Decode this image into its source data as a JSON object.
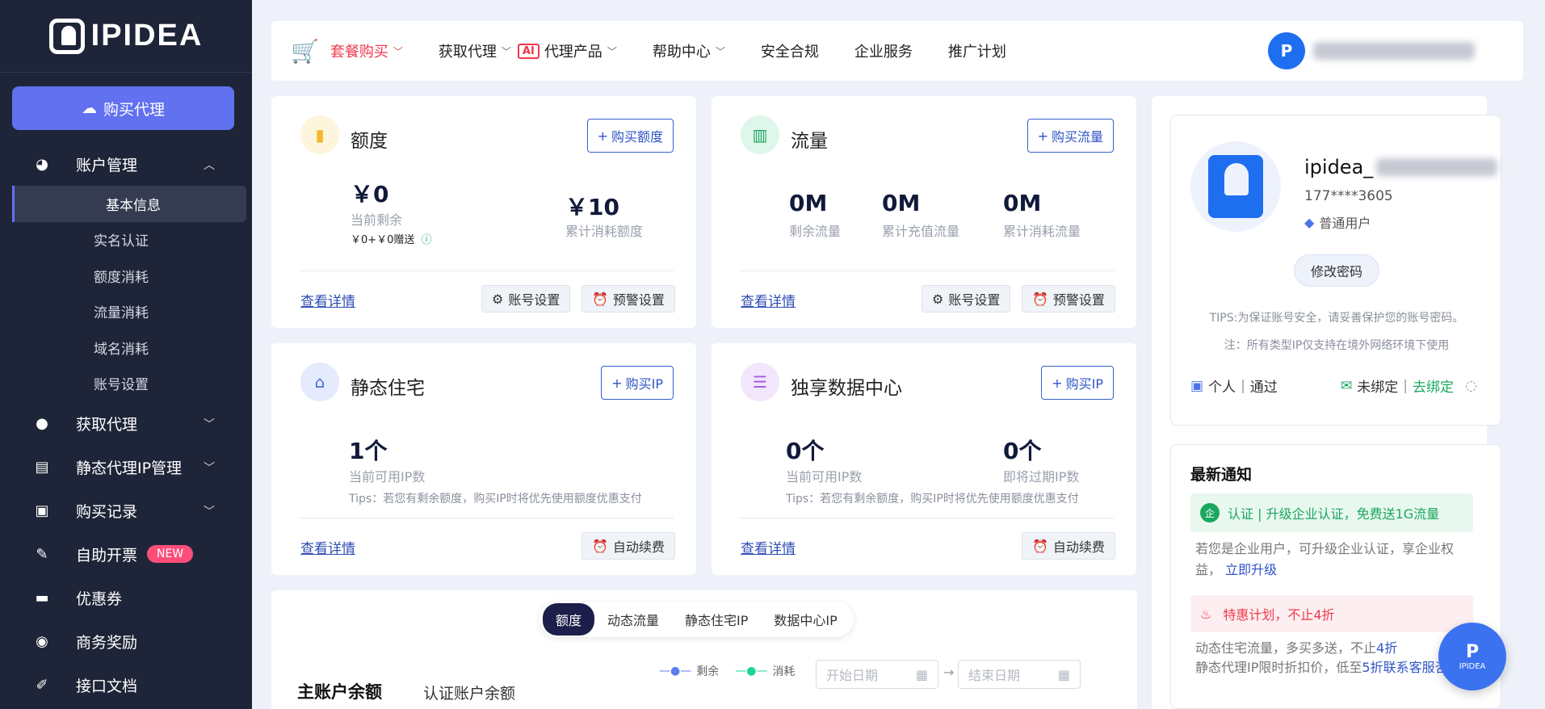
{
  "sidebar": {
    "logo_text": "IPIDEA",
    "buy_button": "购买代理",
    "menu": [
      {
        "label": "账户管理",
        "icon": "pie-chart-icon"
      },
      {
        "label": "获取代理",
        "icon": "user-pin-icon"
      },
      {
        "label": "静态代理IP管理",
        "icon": "static-ip-icon"
      },
      {
        "label": "购买记录",
        "icon": "basket-icon"
      },
      {
        "label": "自助开票",
        "icon": "invoice-icon",
        "badge": "NEW"
      },
      {
        "label": "优惠券",
        "icon": "coupon-icon"
      },
      {
        "label": "商务奖励",
        "icon": "reward-icon"
      },
      {
        "label": "接口文档",
        "icon": "doc-edit-icon"
      }
    ],
    "submenu": [
      "基本信息",
      "实名认证",
      "额度消耗",
      "流量消耗",
      "域名消耗",
      "账号设置"
    ]
  },
  "topnav": {
    "items": [
      "套餐购买",
      "获取代理",
      "代理产品",
      "帮助中心",
      "安全合规",
      "企业服务",
      "推广计划"
    ],
    "ai_badge": "AI"
  },
  "quota_card": {
    "title": "额度",
    "buy": "购买额度",
    "remain_value": "￥0",
    "remain_label": "当前剩余",
    "remain_sub": "￥0+￥0赠送",
    "total_value": "￥10",
    "total_label": "累计消耗额度",
    "detail": "查看详情",
    "account_settings": "账号设置",
    "alert_settings": "预警设置"
  },
  "traffic_card": {
    "title": "流量",
    "buy": "购买流量",
    "stats": [
      {
        "value": "0M",
        "label": "剩余流量"
      },
      {
        "value": "0M",
        "label": "累计充值流量"
      },
      {
        "value": "0M",
        "label": "累计消耗流量"
      }
    ],
    "detail": "查看详情",
    "account_settings": "账号设置",
    "alert_settings": "预警设置"
  },
  "static_card": {
    "title": "静态住宅",
    "buy": "购买IP",
    "value": "1个",
    "label": "当前可用IP数",
    "tip": "Tips：若您有剩余额度，购买IP时将优先使用额度优惠支付",
    "detail": "查看详情",
    "renew": "自动续费"
  },
  "dc_card": {
    "title": "独享数据中心",
    "buy": "购买IP",
    "value1": "0个",
    "label1": "当前可用IP数",
    "value2": "0个",
    "label2": "即将过期IP数",
    "tip": "Tips：若您有剩余额度，购买IP时将优先使用额度优惠支付",
    "detail": "查看详情",
    "renew": "自动续费"
  },
  "bottom": {
    "tabs": [
      "额度",
      "动态流量",
      "静态住宅IP",
      "数据中心IP"
    ],
    "title": "主账户余额",
    "sub_title": "认证账户余额",
    "legend_remain": "剩余",
    "legend_consume": "消耗",
    "start_placeholder": "开始日期",
    "end_placeholder": "结束日期"
  },
  "profile": {
    "name": "ipidea_",
    "phone": "177****3605",
    "level": "普通用户",
    "change_pwd": "修改密码",
    "tips": "TIPS:为保证账号安全，请妥善保护您的账号密码。",
    "note": "注：所有类型IP仅支持在境外网络环境下使用",
    "personal": "个人",
    "passed": "通过",
    "wechat_status": "未绑定",
    "bind": "去绑定"
  },
  "notice": {
    "title": "最新通知",
    "item1_title": "认证 | 升级企业认证，免费送1G流量",
    "item1_body": "若您是企业用户，可升级企业认证，享企业权益，",
    "item1_link": "立即升级",
    "item2_title": "特惠计划，不止4折",
    "item2_line1": "动态住宅流量，多买多送，不止",
    "item2_line1_hl": "4折",
    "item2_line2": "静态代理IP限时折扣价，低至",
    "item2_line2_hl": "5折",
    "item2_link": "联系客服咨询"
  },
  "float_label": "IPIDEA",
  "colors": {
    "accent": "#6171f0",
    "sidebar": "#1f2538",
    "link": "#2f4cb5",
    "green": "#1aa760",
    "hot": "#f0384c"
  }
}
